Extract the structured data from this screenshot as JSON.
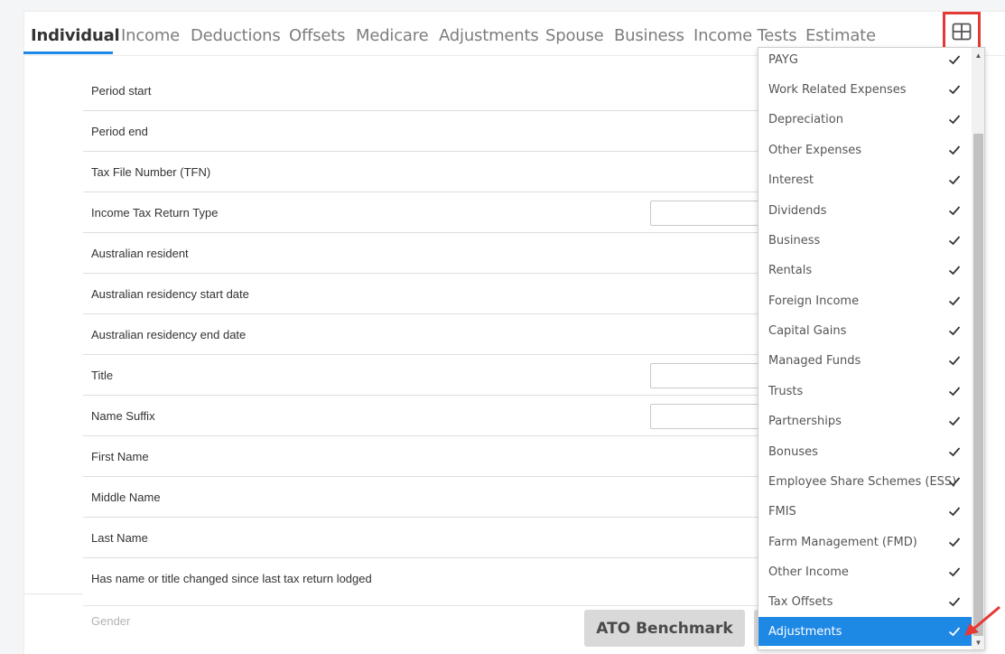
{
  "tabs": [
    {
      "label": "Individual",
      "active": true
    },
    {
      "label": "Income"
    },
    {
      "label": "Deductions"
    },
    {
      "label": "Offsets"
    },
    {
      "label": "Medicare"
    },
    {
      "label": "Adjustments"
    },
    {
      "label": "Spouse"
    },
    {
      "label": "Business"
    },
    {
      "label": "Income Tests"
    },
    {
      "label": "Estimate"
    }
  ],
  "form": {
    "rows": [
      {
        "label": "Period start"
      },
      {
        "label": "Period end"
      },
      {
        "label": "Tax File Number (TFN)"
      },
      {
        "label": "Income Tax Return Type",
        "value": ""
      },
      {
        "label": "Australian resident"
      },
      {
        "label": "Australian residency start date"
      },
      {
        "label": "Australian residency end date"
      },
      {
        "label": "Title",
        "value": ""
      },
      {
        "label": "Name Suffix",
        "value": ""
      },
      {
        "label": "First Name"
      },
      {
        "label": "Middle Name"
      },
      {
        "label": "Last Name"
      },
      {
        "label": "Has name or title changed since last tax return lodged"
      }
    ],
    "gender_label": "Gender"
  },
  "buttons": {
    "ato_benchmark": "ATO Benchmark"
  },
  "icons": {
    "columns": "grid-icon",
    "check": "check-icon",
    "arrow": "red-arrow-icon"
  },
  "column_menu": {
    "items": [
      {
        "label": "PAYG",
        "checked": true
      },
      {
        "label": "Work Related Expenses",
        "checked": true
      },
      {
        "label": "Depreciation",
        "checked": true
      },
      {
        "label": "Other Expenses",
        "checked": true
      },
      {
        "label": "Interest",
        "checked": true
      },
      {
        "label": "Dividends",
        "checked": true
      },
      {
        "label": "Business",
        "checked": true
      },
      {
        "label": "Rentals",
        "checked": true
      },
      {
        "label": "Foreign Income",
        "checked": true
      },
      {
        "label": "Capital Gains",
        "checked": true
      },
      {
        "label": "Managed Funds",
        "checked": true
      },
      {
        "label": "Trusts",
        "checked": true
      },
      {
        "label": "Partnerships",
        "checked": true
      },
      {
        "label": "Bonuses",
        "checked": true
      },
      {
        "label": "Employee Share Schemes (ESS)",
        "checked": true
      },
      {
        "label": "FMIS",
        "checked": true
      },
      {
        "label": "Farm Management (FMD)",
        "checked": true
      },
      {
        "label": "Other Income",
        "checked": true
      },
      {
        "label": "Tax Offsets",
        "checked": true
      },
      {
        "label": "Adjustments",
        "checked": true,
        "selected": true
      }
    ]
  },
  "colors": {
    "accent": "#1e88e5",
    "highlight_box": "#e53935",
    "arrow": "#e53935"
  }
}
